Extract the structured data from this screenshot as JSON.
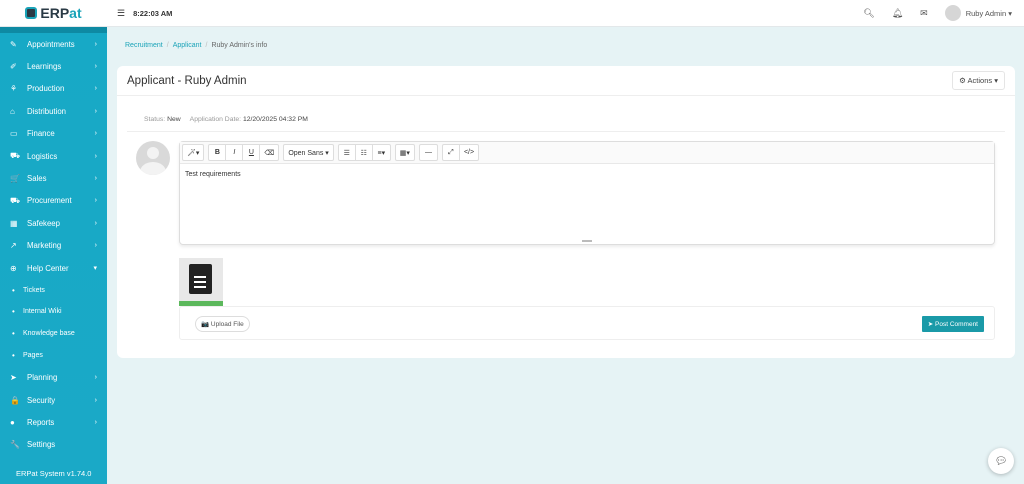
{
  "app": {
    "logo_prefix": "ERP",
    "logo_suffix": "at",
    "time": "8:22:03 AM",
    "user": "Ruby Admin"
  },
  "sidebar": {
    "items": [
      {
        "label": "Appointments",
        "icon": "✎",
        "chev": "›"
      },
      {
        "label": "Learnings",
        "icon": "✐",
        "chev": "›"
      },
      {
        "label": "Production",
        "icon": "⚘",
        "chev": "›"
      },
      {
        "label": "Distribution",
        "icon": "⌂",
        "chev": "›"
      },
      {
        "label": "Finance",
        "icon": "▭",
        "chev": "›"
      },
      {
        "label": "Logistics",
        "icon": "⛟",
        "chev": "›"
      },
      {
        "label": "Sales",
        "icon": "🛒",
        "chev": "›"
      },
      {
        "label": "Procurement",
        "icon": "⛟",
        "chev": "›"
      },
      {
        "label": "Safekeep",
        "icon": "▦",
        "chev": "›"
      },
      {
        "label": "Marketing",
        "icon": "↗",
        "chev": "›"
      },
      {
        "label": "Help Center",
        "icon": "⊕",
        "chev": "▾"
      }
    ],
    "sub_items": [
      "Tickets",
      "Internal Wiki",
      "Knowledge base",
      "Pages"
    ],
    "items2": [
      {
        "label": "Planning",
        "icon": "➤",
        "chev": "›"
      },
      {
        "label": "Security",
        "icon": "🔒",
        "chev": "›"
      },
      {
        "label": "Reports",
        "icon": "●",
        "chev": "›"
      },
      {
        "label": "Settings",
        "icon": "🔧",
        "chev": ""
      }
    ],
    "footer": "ERPat System v1.74.0"
  },
  "breadcrumb": [
    "Recruitment",
    "Applicant",
    "Ruby Admin's info"
  ],
  "card": {
    "title": "Applicant - Ruby Admin",
    "actions": "Actions ▾",
    "status_label": "Status:",
    "status": "New",
    "date_label": "Application Date:",
    "date": "12/20/2025 04:32 PM"
  },
  "editor": {
    "font": "Open Sans ▾",
    "content": "Test requirements"
  },
  "attachment": {
    "progress_percent": 100
  },
  "buttons": {
    "upload": "📷 Upload File",
    "post": "➤ Post Comment"
  }
}
